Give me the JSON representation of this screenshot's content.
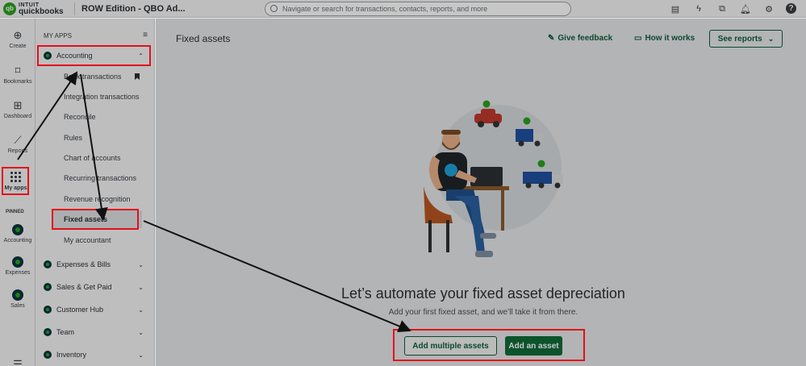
{
  "topbar": {
    "logo_line1": "INTUIT",
    "logo_line2": "quickbooks",
    "logo_mark": "qb",
    "company": "ROW Edition - QBO Ad...",
    "search_placeholder": "Navigate or search for transactions, contacts, reports, and more",
    "icons": [
      "clipboard-icon",
      "lightning-icon",
      "apps-icon",
      "bell-icon",
      "gear-icon",
      "help-icon"
    ],
    "help_glyph": "?"
  },
  "rail": {
    "create": "Create",
    "bookmarks": "Bookmarks",
    "dashboard": "Dashboard",
    "reports": "Reports",
    "my_apps": "My apps",
    "pinned": "PINNED",
    "pinned_items": [
      "Accounting",
      "Expenses",
      "Sales"
    ]
  },
  "panel": {
    "heading": "MY APPS",
    "accounting": "Accounting",
    "sub_items": [
      "Bank transactions",
      "Integration transactions",
      "Reconcile",
      "Rules",
      "Chart of accounts",
      "Recurring transactions",
      "Revenue recognition",
      "Fixed assets",
      "My accountant"
    ],
    "categories": [
      "Expenses & Bills",
      "Sales & Get Paid",
      "Customer Hub",
      "Team",
      "Inventory"
    ]
  },
  "main": {
    "title": "Fixed assets",
    "give_feedback": "Give feedback",
    "how_it_works": "How it works",
    "see_reports": "See reports",
    "headline": "Let’s automate your fixed asset depreciation",
    "subline": "Add your first fixed asset, and we’ll take it from there.",
    "add_multiple": "Add multiple assets",
    "add_asset": "Add an asset"
  },
  "colors": {
    "brand_green": "#2ca01c",
    "button_green": "#0f6b38",
    "link_green": "#0f5c3b",
    "annotation_red": "#e3101a"
  }
}
